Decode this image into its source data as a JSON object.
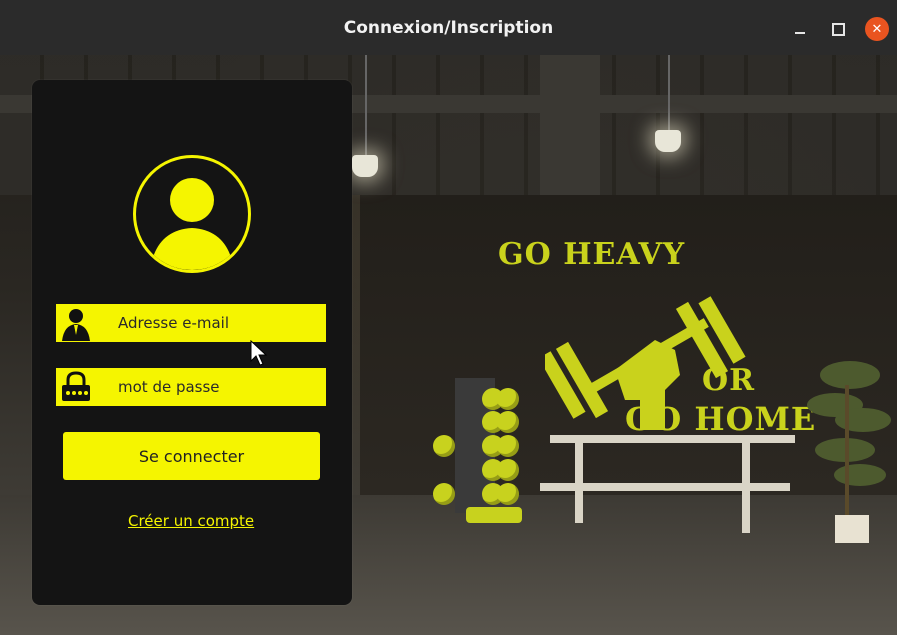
{
  "window": {
    "title": "Connexion/Inscription",
    "controls": {
      "minimize_icon": "minimize-icon",
      "maximize_icon": "maximize-icon",
      "close_icon": "close-icon",
      "close_color": "#e95420"
    }
  },
  "background": {
    "mural_line1": "GO HEAVY",
    "mural_line2": "OR",
    "mural_line3": "GO HOME",
    "accent_color": "#c9d21c"
  },
  "login": {
    "avatar_icon": "user-avatar-icon",
    "email": {
      "icon": "user-suit-icon",
      "placeholder": "Adresse e-mail",
      "value": ""
    },
    "password": {
      "icon": "lock-icon",
      "placeholder": "mot de passe",
      "value": ""
    },
    "submit_label": "Se connecter",
    "create_account_label": "Créer un compte",
    "accent_color": "#f5f500",
    "panel_color": "#141414"
  }
}
